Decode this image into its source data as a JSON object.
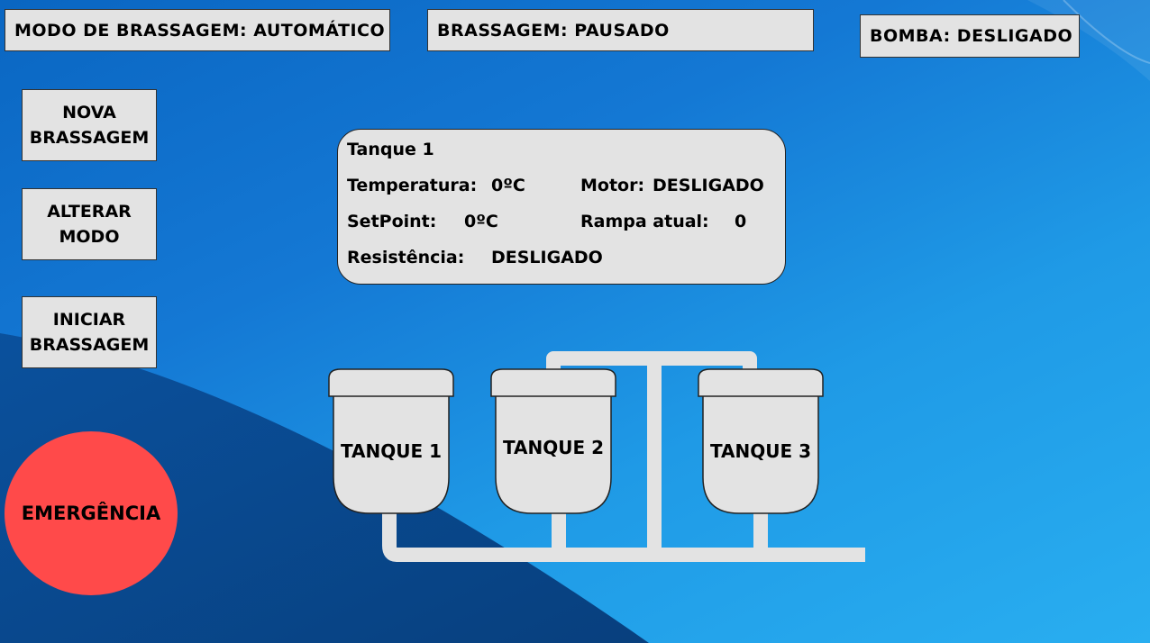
{
  "status": {
    "mode": "MODO DE BRASSAGEM:  AUTOMÁTICO",
    "brewing": "BRASSAGEM:    PAUSADO",
    "pump": "BOMBA: DESLIGADO"
  },
  "buttons": {
    "new": "NOVA\nBRASSAGEM",
    "alter": "ALTERAR\nMODO",
    "start": "INICIAR\nBRASSAGEM",
    "emergency": "EMERGÊNCIA"
  },
  "panel": {
    "title": "Tanque 1",
    "temp_label": "Temperatura:",
    "temp_value": "0ºC",
    "setpoint_label": "SetPoint:",
    "setpoint_value": "0ºC",
    "resist_label": "Resistência:",
    "resist_value": "DESLIGADO",
    "motor_label": "Motor:",
    "motor_value": "DESLIGADO",
    "ramp_label": "Rampa atual:",
    "ramp_value": "0"
  },
  "tanks": {
    "t1": "TANQUE 1",
    "t2": "TANQUE 2",
    "t3": "TANQUE 3"
  },
  "colors": {
    "emergency": "#ff4a4a",
    "box": "#e3e3e3",
    "background": "#1a8ae0"
  }
}
